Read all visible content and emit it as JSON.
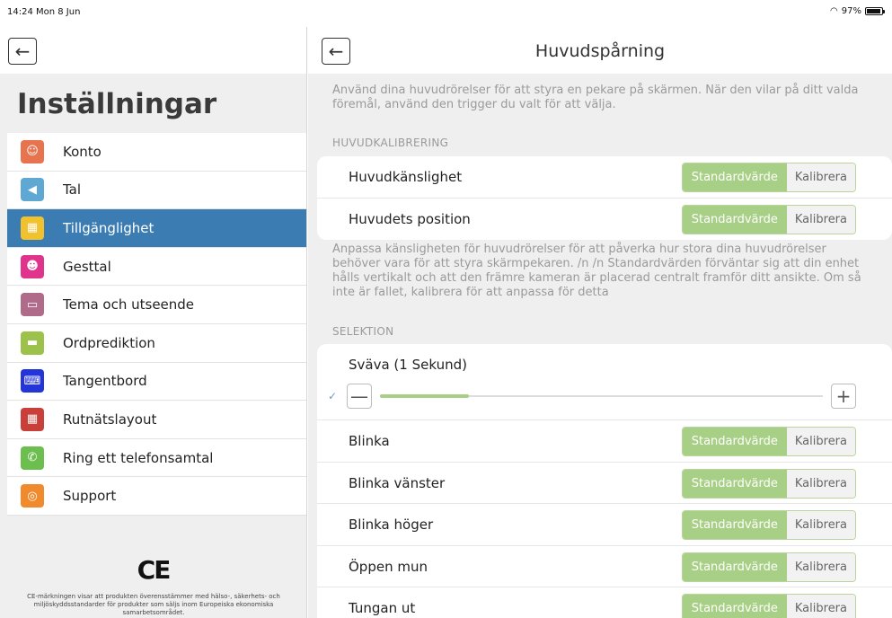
{
  "status": {
    "time": "14:24  Mon 8 Jun",
    "battery": "97%",
    "wifi_icon": "wifi-icon"
  },
  "sidebar": {
    "title": "Inställningar",
    "items": [
      {
        "label": "Konto",
        "icon": "person-icon",
        "color": "#e8744f",
        "glyph": "☺"
      },
      {
        "label": "Tal",
        "icon": "speaker-icon",
        "color": "#5fa8d3",
        "glyph": "◀"
      },
      {
        "label": "Tillgänglighet",
        "icon": "accessibility-icon",
        "color": "#f2c12e",
        "glyph": "▦",
        "active": true
      },
      {
        "label": "Gesttal",
        "icon": "face-icon",
        "color": "#e0338c",
        "glyph": "☻"
      },
      {
        "label": "Tema och utseende",
        "icon": "theme-icon",
        "color": "#b06a8a",
        "glyph": "▭"
      },
      {
        "label": "Ordprediktion",
        "icon": "prediction-icon",
        "color": "#9cc24b",
        "glyph": "▬"
      },
      {
        "label": "Tangentbord",
        "icon": "keyboard-icon",
        "color": "#2334d9",
        "glyph": "⌨"
      },
      {
        "label": "Rutnätslayout",
        "icon": "grid-icon",
        "color": "#c9403a",
        "glyph": "▦"
      },
      {
        "label": "Ring ett telefonsamtal",
        "icon": "phone-icon",
        "color": "#6cbf4e",
        "glyph": "✆"
      },
      {
        "label": "Support",
        "icon": "lifebuoy-icon",
        "color": "#f08a2c",
        "glyph": "◎"
      }
    ],
    "ce_mark": "CE",
    "ce_text": "CE-märkningen visar att produkten överensstämmer med hälso-, säkerhets- och miljöskyddsstandarder för produkter som säljs inom Europeiska ekonomiska samarbetsområdet."
  },
  "main": {
    "title": "Huvudspårning",
    "intro": "Använd dina huvudrörelser för att styra en pekare på skärmen. När den vilar på ditt valda föremål, använd den trigger du valt för att välja.",
    "calibration_header": "HUVUDKALIBRERING",
    "calibration_rows": [
      {
        "label": "Huvudkänslighet"
      },
      {
        "label": "Huvudets position"
      }
    ],
    "calibration_note": "Anpassa känsligheten för huvudrörelser för att påverka hur stora dina huvudrörelser behöver vara för att styra skärmpekaren. /n /n Standardvärden förväntar sig att din enhet hålls vertikalt och att den främre kameran är placerad centralt framför ditt ansikte. Om så inte är fallet, kalibrera för att anpassa för detta",
    "selection_header": "SELEKTION",
    "hover": {
      "label": "Sväva (1 Sekund)",
      "level": 0.2,
      "minus": "—",
      "plus": "+"
    },
    "selection_rows": [
      {
        "label": "Blinka"
      },
      {
        "label": "Blinka vänster"
      },
      {
        "label": "Blinka höger"
      },
      {
        "label": "Öppen mun"
      },
      {
        "label": "Tungan ut"
      }
    ],
    "default_label": "Standardvärde",
    "calibrate_label": "Kalibrera",
    "accent_color": "#a8cf86",
    "active_color": "#3b7db3"
  },
  "back_icon": "←"
}
